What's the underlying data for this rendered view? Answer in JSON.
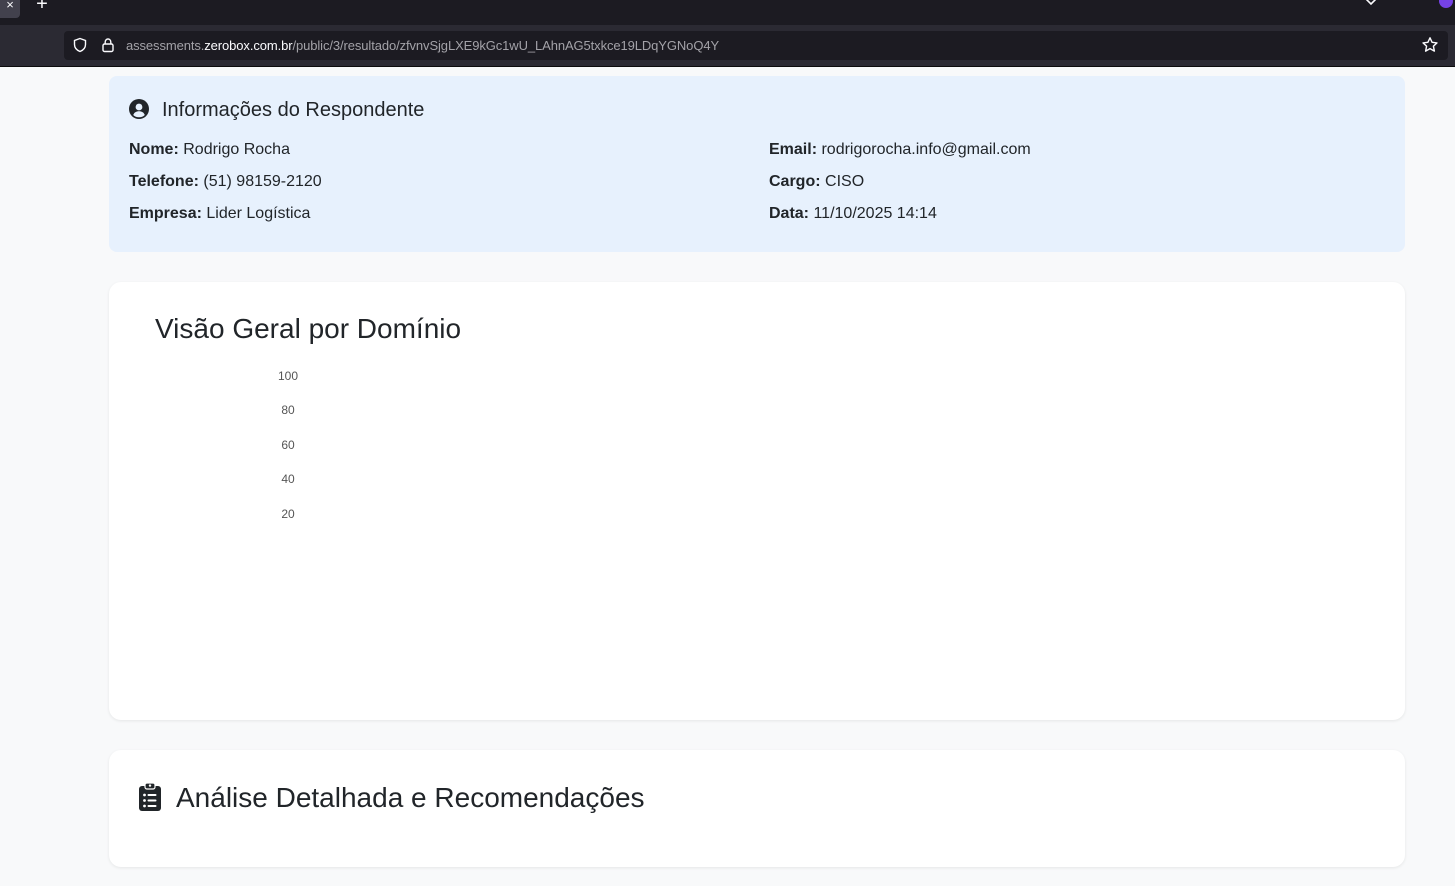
{
  "browser": {
    "tab_close_glyph": "×",
    "new_tab_glyph": "+",
    "url": {
      "prefix": "assessments.",
      "host": "zerobox.com.br",
      "path": "/public/3/resultado/zfvnvSjgLXE9kGc1wU_LAhnAG5txkce19LDqYGNoQ4Y"
    },
    "icons": {
      "shield": "shield-icon",
      "lock": "lock-icon",
      "bookmark": "star-icon",
      "tab_list": "chevron-down-icon",
      "extension": "extension-icon"
    },
    "colors": {
      "extension_badge": "#7542e5"
    }
  },
  "respondent": {
    "title": "Informações do Respondente",
    "icon": "user-circle-icon",
    "fields": {
      "nome": {
        "label": "Nome:",
        "value": "Rodrigo Rocha"
      },
      "telefone": {
        "label": "Telefone:",
        "value": "(51) 98159-2120"
      },
      "empresa": {
        "label": "Empresa:",
        "value": "Lider Logística"
      },
      "email": {
        "label": "Email:",
        "value": "rodrigorocha.info@gmail.com"
      },
      "cargo": {
        "label": "Cargo:",
        "value": "CISO"
      },
      "data": {
        "label": "Data:",
        "value": "11/10/2025 14:14"
      }
    },
    "colors": {
      "background": "#e7f1fd"
    }
  },
  "overview": {
    "title": "Visão Geral por Domínio"
  },
  "chart_data": {
    "type": "radar",
    "ticks": [
      "100",
      "80",
      "60",
      "40",
      "20"
    ],
    "rlim": [
      0,
      100
    ],
    "series": []
  },
  "analysis": {
    "title": "Análise Detalhada e Recomendações",
    "icon": "clipboard-list-icon"
  }
}
